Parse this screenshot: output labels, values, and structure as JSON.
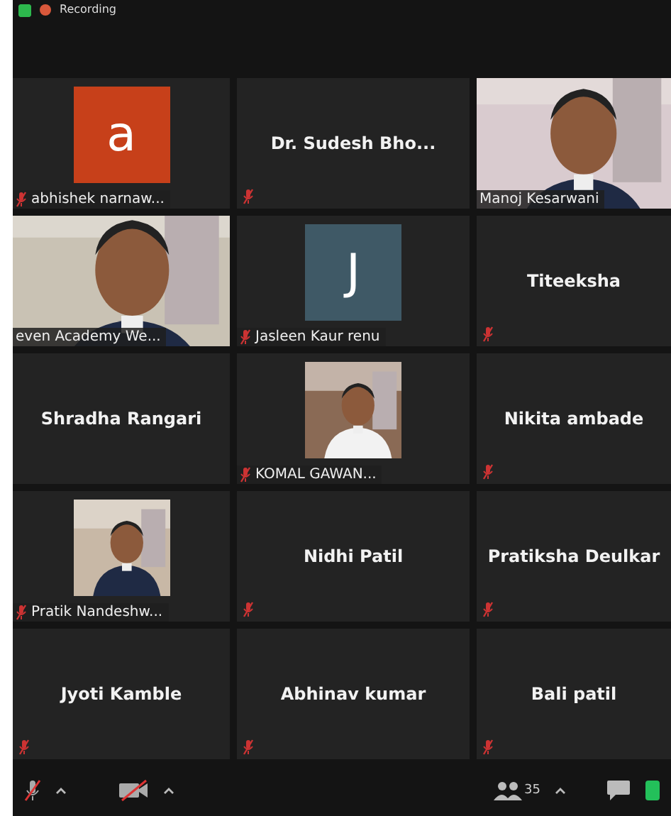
{
  "top_bar": {
    "recording_label": "Recording"
  },
  "tiles": [
    {
      "kind": "avatar",
      "letter": "a",
      "color": "#c7401a",
      "label": "abhishek narnaw...",
      "muted": true
    },
    {
      "kind": "name",
      "label": "Dr. Sudesh Bho...",
      "muted": true
    },
    {
      "kind": "video",
      "label": "Manoj Kesarwani",
      "muted": false
    },
    {
      "kind": "video",
      "label": "even Academy We...",
      "muted": false
    },
    {
      "kind": "avatar",
      "letter": "J",
      "color": "#3f5966",
      "label": "Jasleen Kaur renu",
      "muted": true
    },
    {
      "kind": "name",
      "label": "Titeeksha",
      "muted": true
    },
    {
      "kind": "name",
      "label": "Shradha Rangari",
      "muted": false
    },
    {
      "label": "KOMAL GAWAN...",
      "muted": true
    },
    {
      "kind": "name",
      "label": "Nikita ambade",
      "muted": true
    },
    {
      "label": "Pratik Nandeshw...",
      "muted": true
    },
    {
      "kind": "name",
      "label": "Nidhi Patil",
      "muted": true
    },
    {
      "kind": "name",
      "label": "Pratiksha Deulkar",
      "muted": true
    },
    {
      "kind": "name",
      "label": "Jyoti Kamble",
      "muted": true
    },
    {
      "kind": "name",
      "label": "Abhinav kumar",
      "muted": true
    },
    {
      "kind": "name",
      "label": "Bali patil",
      "muted": true
    }
  ],
  "toolbar": {
    "participants_count": "35"
  }
}
